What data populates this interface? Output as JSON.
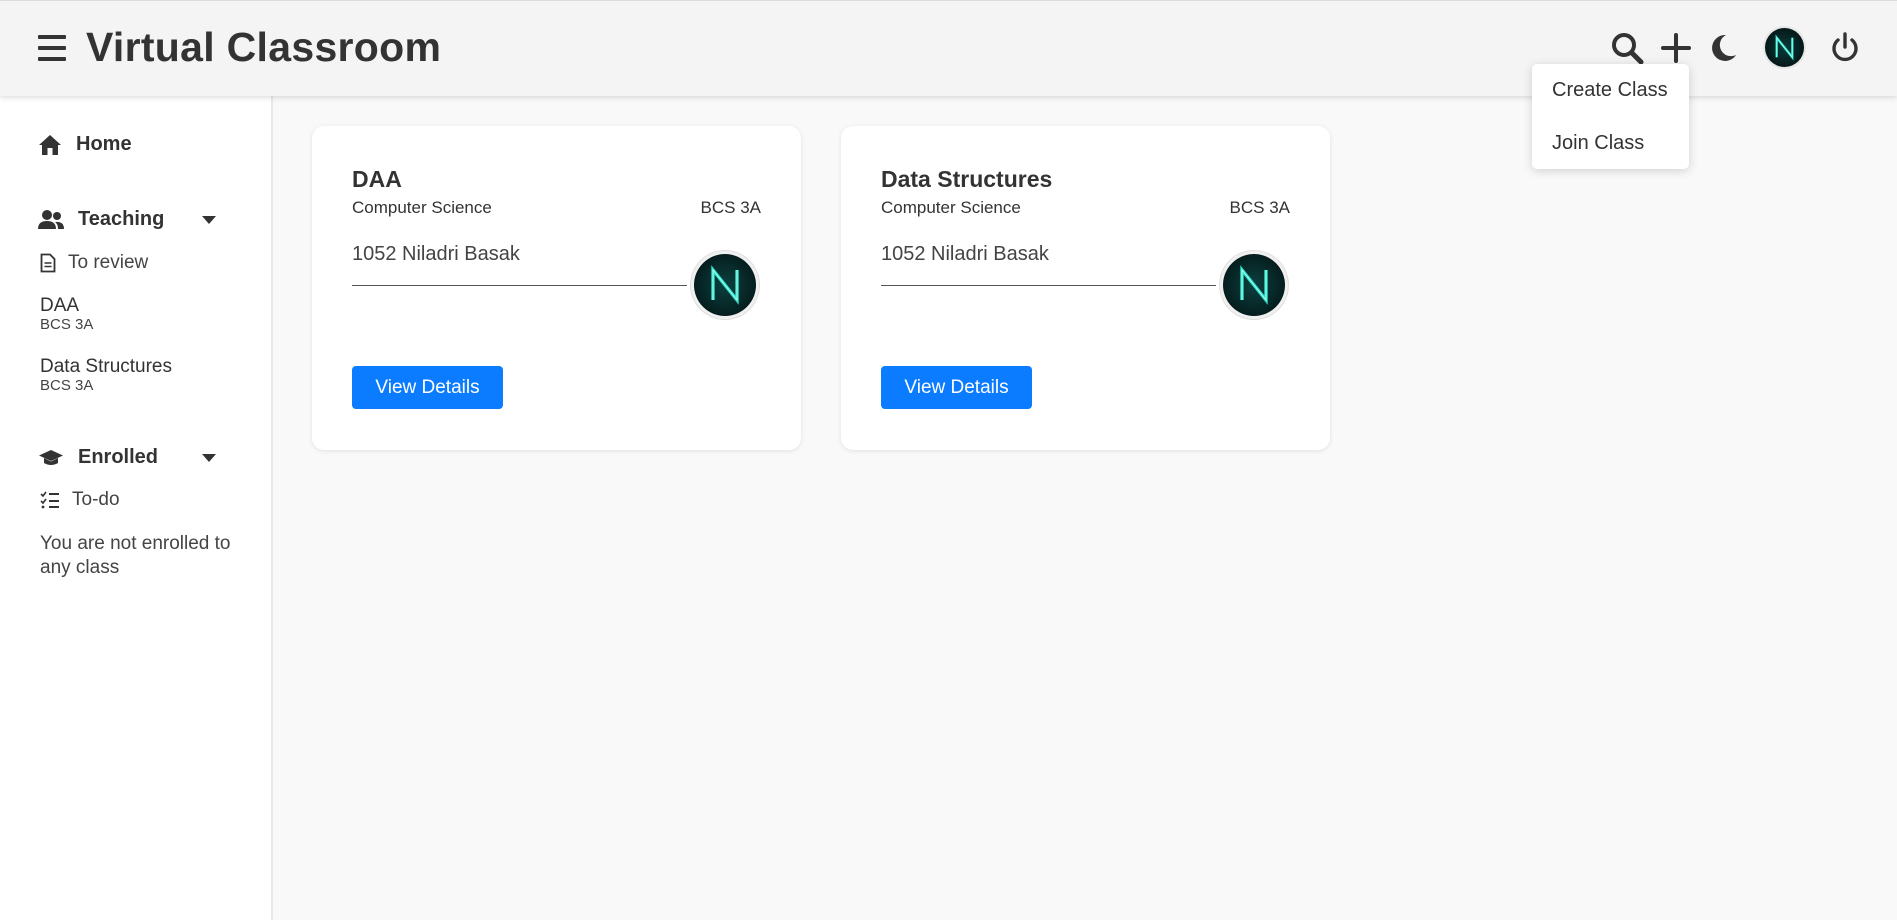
{
  "header": {
    "title": "Virtual Classroom",
    "icons": [
      "menu-icon",
      "search-icon",
      "plus-icon",
      "moon-icon",
      "avatar",
      "power-icon"
    ]
  },
  "dropdown": {
    "items": [
      "Create Class",
      "Join Class"
    ]
  },
  "sidebar": {
    "home": "Home",
    "teaching": {
      "label": "Teaching",
      "review": "To review",
      "classes": [
        {
          "name": "DAA",
          "section": "BCS 3A"
        },
        {
          "name": "Data Structures",
          "section": "BCS 3A"
        }
      ]
    },
    "enrolled": {
      "label": "Enrolled",
      "todo": "To-do",
      "note": "You are not enrolled to any class"
    }
  },
  "cards": [
    {
      "title": "DAA",
      "subject": "Computer Science",
      "section": "BCS 3A",
      "teacher": "1052 Niladri Basak",
      "button": "View Details"
    },
    {
      "title": "Data Structures",
      "subject": "Computer Science",
      "section": "BCS 3A",
      "teacher": "1052 Niladri Basak",
      "button": "View Details"
    }
  ],
  "colors": {
    "accent": "#0b7bff",
    "header_bg": "#f4f4f4",
    "avatar_glow": "#2de0c8"
  }
}
